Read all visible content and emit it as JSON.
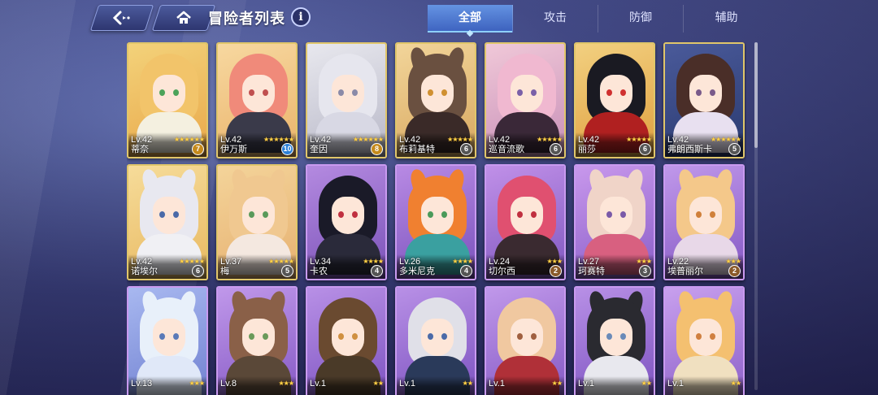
{
  "header": {
    "title": "冒险者列表",
    "back_icon": "back-arrow-icon",
    "home_icon": "home-icon",
    "info_label": "i"
  },
  "tabs": [
    {
      "label": "全部",
      "active": true
    },
    {
      "label": "攻击",
      "active": false
    },
    {
      "label": "防御",
      "active": false
    },
    {
      "label": "辅助",
      "active": false
    }
  ],
  "colors": {
    "gold_frame": "#e0c66a",
    "purple_frame": "#c99af0",
    "star": "#ffd34a",
    "tab_active": "#4f8ef0"
  },
  "adventurers": [
    {
      "level": "Lv.42",
      "name": "蒂奈",
      "stars": "★★★★★★",
      "badge": "7",
      "badge_color": "gold",
      "frame": "gold",
      "bg": [
        "#f3d27a",
        "#e9a84a"
      ],
      "hair": "#f2c46a",
      "eye": "#4ca35a",
      "outfit": "#f4f0e0",
      "ears": false
    },
    {
      "level": "Lv.42",
      "name": "伊万斯",
      "stars": "★★★★★★",
      "badge": "10",
      "badge_color": "blue",
      "frame": "gold",
      "bg": [
        "#f7d8a0",
        "#eab36a"
      ],
      "hair": "#f08a7a",
      "eye": "#c05050",
      "outfit": "#3a3a4a",
      "ears": false
    },
    {
      "level": "Lv.42",
      "name": "奎因",
      "stars": "★★★★★★",
      "badge": "8",
      "badge_color": "gold",
      "frame": "gold",
      "bg": [
        "#e8e8ee",
        "#b8b8c8"
      ],
      "hair": "#e6e6ee",
      "eye": "#8a8aa8",
      "outfit": "#d8d8e4",
      "ears": false
    },
    {
      "level": "Lv.42",
      "name": "布莉基特",
      "stars": "★★★★★",
      "badge": "6",
      "badge_color": "gray",
      "frame": "gold",
      "bg": [
        "#f2d59a",
        "#d8a860"
      ],
      "hair": "#6a5040",
      "eye": "#d09030",
      "outfit": "#3a2a28",
      "ears": true
    },
    {
      "level": "Lv.42",
      "name": "巡音流歌",
      "stars": "★★★★★",
      "badge": "6",
      "badge_color": "gray",
      "frame": "gold",
      "bg": [
        "#f0c8d8",
        "#c890b8"
      ],
      "hair": "#f0b8d0",
      "eye": "#7a60a8",
      "outfit": "#3a2838",
      "ears": false
    },
    {
      "level": "Lv.42",
      "name": "丽莎",
      "stars": "★★★★★",
      "badge": "6",
      "badge_color": "gray",
      "frame": "gold",
      "bg": [
        "#f2d080",
        "#e0a040"
      ],
      "hair": "#1a1a22",
      "eye": "#d03030",
      "outfit": "#b02020",
      "ears": false
    },
    {
      "level": "Lv.42",
      "name": "弗朗西斯卡",
      "stars": "★★★★★★",
      "badge": "5",
      "badge_color": "gray",
      "frame": "gold",
      "bg": [
        "#4a5a9a",
        "#2a3a70"
      ],
      "hair": "#4a2e28",
      "eye": "#7a5a8a",
      "outfit": "#e8e0f0",
      "ears": false
    },
    {
      "level": "Lv.42",
      "name": "诺埃尔",
      "stars": "★★★★★",
      "badge": "6",
      "badge_color": "gray",
      "frame": "gold",
      "bg": [
        "#f6dc9a",
        "#e8b860"
      ],
      "hair": "#e8e8f0",
      "eye": "#4a6aa8",
      "outfit": "#f0f0f4",
      "ears": true
    },
    {
      "level": "Lv.37",
      "name": "梅",
      "stars": "★★★★★",
      "badge": "5",
      "badge_color": "gray",
      "frame": "gold",
      "bg": [
        "#f4d49a",
        "#e6b070"
      ],
      "hair": "#f0c890",
      "eye": "#5a9a5a",
      "outfit": "#f4e8e0",
      "ears": true
    },
    {
      "level": "Lv.34",
      "name": "卡农",
      "stars": "★★★★",
      "badge": "4",
      "badge_color": "gray",
      "frame": "purple",
      "bg": [
        "#b48ae0",
        "#7a52b8"
      ],
      "hair": "#1a1a28",
      "eye": "#c03040",
      "outfit": "#2a2a3a",
      "ears": false
    },
    {
      "level": "Lv.26",
      "name": "多米尼克",
      "stars": "★★★★",
      "badge": "4",
      "badge_color": "gray",
      "frame": "purple",
      "bg": [
        "#b88ae4",
        "#7a52bc"
      ],
      "hair": "#f08030",
      "eye": "#4a9a5a",
      "outfit": "#3aa0a0",
      "ears": true
    },
    {
      "level": "Lv.24",
      "name": "切尔西",
      "stars": "★★★",
      "badge": "2",
      "badge_color": "brown",
      "frame": "purple",
      "bg": [
        "#c090e8",
        "#8058c0"
      ],
      "hair": "#e05070",
      "eye": "#c03040",
      "outfit": "#3a2a30",
      "ears": false
    },
    {
      "level": "Lv.27",
      "name": "珂赛特",
      "stars": "★★★",
      "badge": "3",
      "badge_color": "gray",
      "frame": "purple",
      "bg": [
        "#c898ec",
        "#8a5ec8"
      ],
      "hair": "#f0d4c8",
      "eye": "#7a5aa8",
      "outfit": "#d86080",
      "ears": true
    },
    {
      "level": "Lv.22",
      "name": "埃普丽尔",
      "stars": "★★★",
      "badge": "2",
      "badge_color": "brown",
      "frame": "purple",
      "bg": [
        "#c098ea",
        "#8458c4"
      ],
      "hair": "#f4c88a",
      "eye": "#d0803a",
      "outfit": "#e8d8e8",
      "ears": true
    },
    {
      "level": "Lv.13",
      "name": "",
      "stars": "★★★",
      "badge": "",
      "badge_color": "gray",
      "frame": "purple",
      "bg": [
        "#a8b8f0",
        "#7080d0"
      ],
      "hair": "#e8f0fa",
      "eye": "#5a7ab8",
      "outfit": "#e0e8f8",
      "ears": true
    },
    {
      "level": "Lv.8",
      "name": "",
      "stars": "★★★",
      "badge": "",
      "badge_color": "gray",
      "frame": "purple",
      "bg": [
        "#c098ea",
        "#8458c4"
      ],
      "hair": "#8a6048",
      "eye": "#6a9a5a",
      "outfit": "#5a4838",
      "ears": true
    },
    {
      "level": "Lv.1",
      "name": "",
      "stars": "★★",
      "badge": "",
      "badge_color": "gray",
      "frame": "purple",
      "bg": [
        "#b890e6",
        "#7c52c0"
      ],
      "hair": "#6a4a30",
      "eye": "#d09040",
      "outfit": "#4a3a28",
      "ears": false
    },
    {
      "level": "Lv.1",
      "name": "",
      "stars": "★★",
      "badge": "",
      "badge_color": "gray",
      "frame": "purple",
      "bg": [
        "#b890e6",
        "#7c52c0"
      ],
      "hair": "#e0e0e8",
      "eye": "#4a6aa8",
      "outfit": "#2a3a5a",
      "ears": false
    },
    {
      "level": "Lv.1",
      "name": "",
      "stars": "★★",
      "badge": "",
      "badge_color": "gray",
      "frame": "purple",
      "bg": [
        "#c098ea",
        "#8458c4"
      ],
      "hair": "#f0c8a0",
      "eye": "#a06040",
      "outfit": "#b03038",
      "ears": false
    },
    {
      "level": "Lv.1",
      "name": "",
      "stars": "★★",
      "badge": "",
      "badge_color": "gray",
      "frame": "purple",
      "bg": [
        "#b890e6",
        "#7c52c0"
      ],
      "hair": "#2a2a30",
      "eye": "#6a8ab8",
      "outfit": "#e8e8ee",
      "ears": true
    },
    {
      "level": "Lv.1",
      "name": "",
      "stars": "★★",
      "badge": "",
      "badge_color": "gray",
      "frame": "purple",
      "bg": [
        "#c8a0ee",
        "#8c60c8"
      ],
      "hair": "#f4c070",
      "eye": "#d08040",
      "outfit": "#f0e0c0",
      "ears": true
    }
  ]
}
